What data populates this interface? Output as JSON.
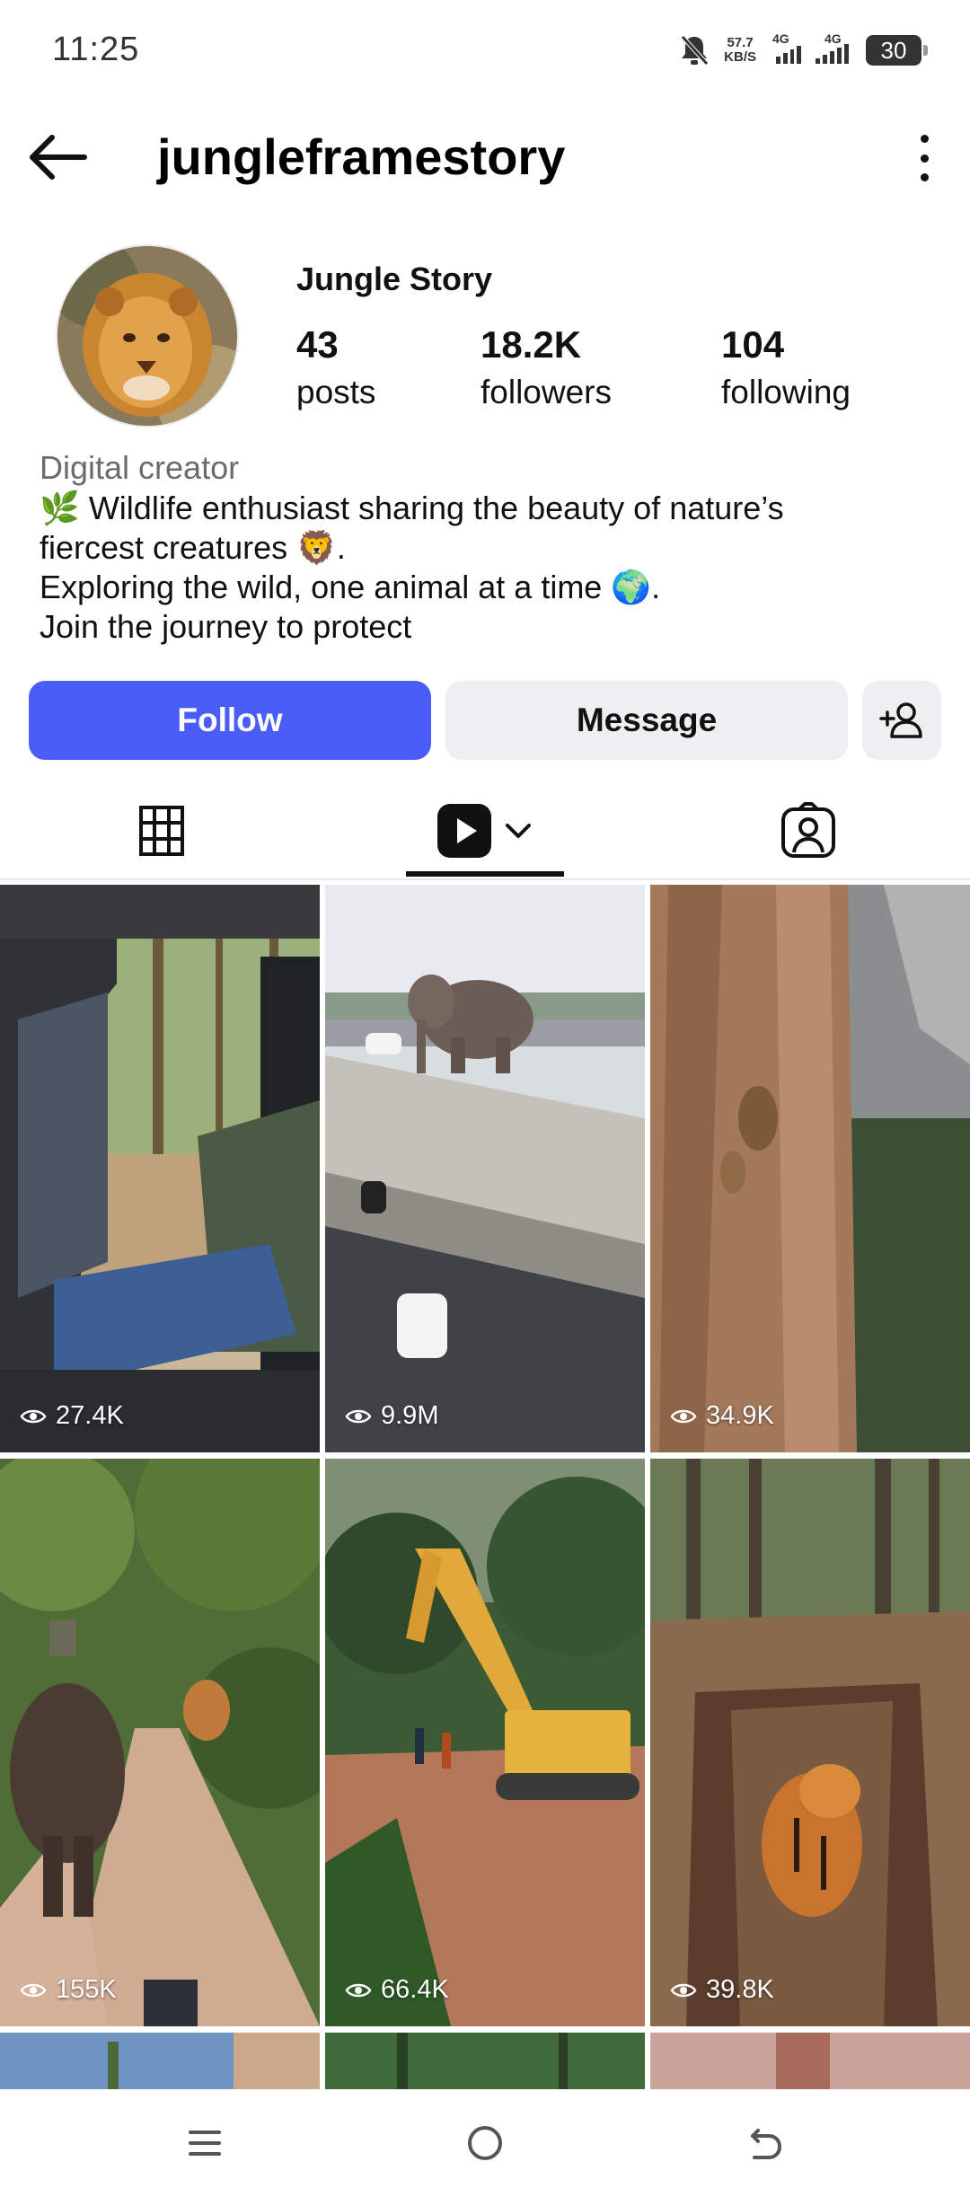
{
  "status_bar": {
    "time": "11:25",
    "speed_top": "57.7",
    "speed_bottom": "KB/S",
    "network_1": "4G",
    "network_2": "4G",
    "battery": "30"
  },
  "header": {
    "username": "jungleframestory"
  },
  "profile": {
    "display_name": "Jungle Story",
    "stats": {
      "posts": {
        "value": "43",
        "label": "posts"
      },
      "followers": {
        "value": "18.2K",
        "label": "followers"
      },
      "following": {
        "value": "104",
        "label": "following"
      }
    },
    "category": "Digital creator",
    "bio": {
      "line1": "🌿 Wildlife enthusiast sharing the beauty of nature’s",
      "line2": "fiercest creatures 🦁.",
      "line3": "Exploring the wild, one animal at a time 🌍.",
      "line4": "Join the journey to protect"
    }
  },
  "actions": {
    "follow_label": "Follow",
    "message_label": "Message"
  },
  "tabs": {
    "active": "reels"
  },
  "reels": [
    {
      "views": "27.4K"
    },
    {
      "views": "9.9M"
    },
    {
      "views": "34.9K"
    },
    {
      "views": "155K"
    },
    {
      "views": "66.4K"
    },
    {
      "views": "39.8K"
    }
  ],
  "colors": {
    "follow_button": "#4a5df9",
    "secondary_button": "#efeff2"
  },
  "icons": {
    "back": "arrow-left",
    "more": "vertical-dots",
    "add_user": "person-plus",
    "grid_tab": "grid",
    "reels_tab": "reels-play",
    "tagged_tab": "person-square",
    "views": "eye"
  }
}
